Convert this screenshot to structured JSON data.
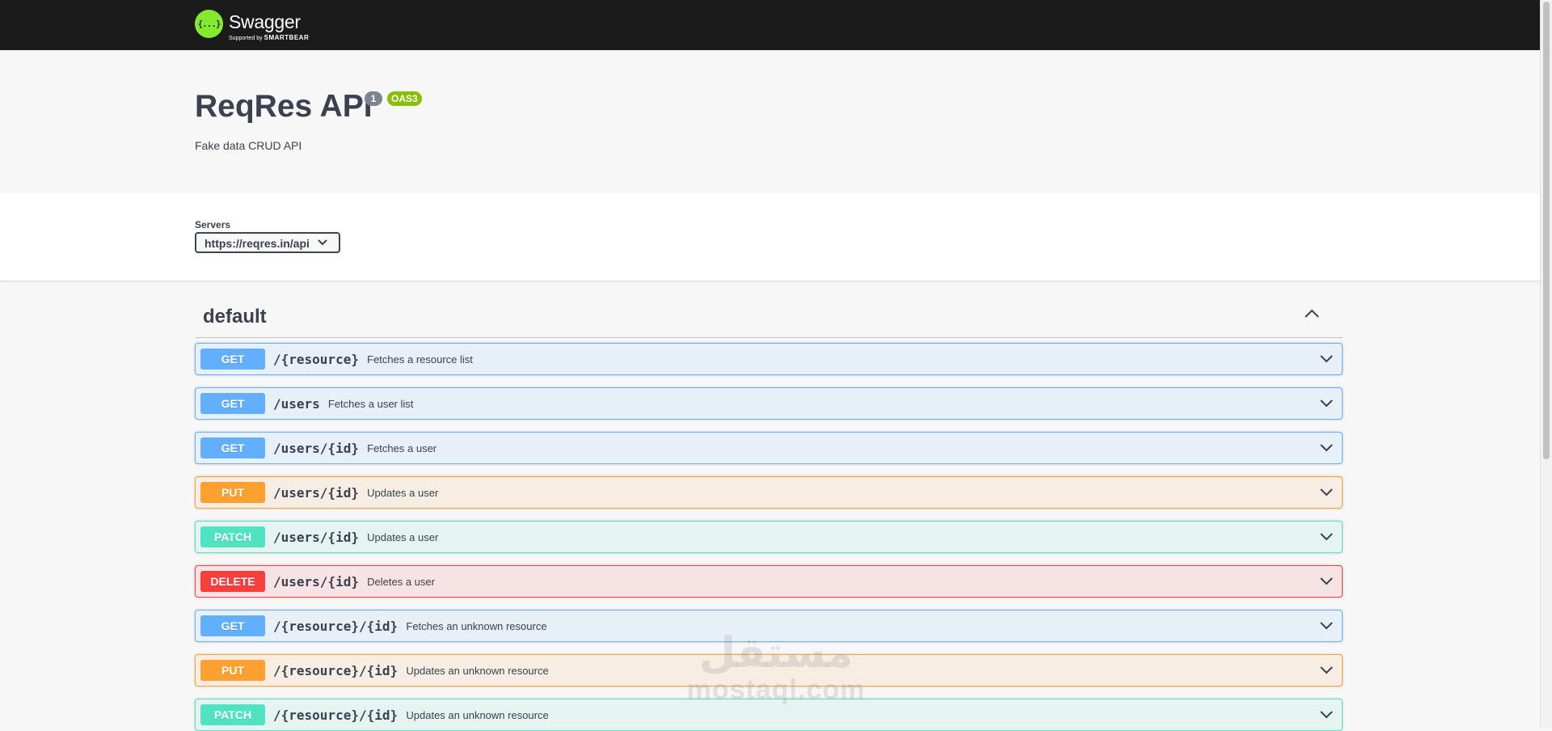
{
  "topbar": {
    "logo_icon_text": "{...}",
    "logo_word": "Swagger",
    "logo_supported": "Supported by",
    "logo_company": "SMARTBEAR"
  },
  "info": {
    "title": "ReqRes API",
    "version": "1",
    "oas_badge": "OAS3",
    "description": "Fake data CRUD API"
  },
  "servers": {
    "label": "Servers",
    "selected": "https://reqres.in/api"
  },
  "tag": {
    "name": "default"
  },
  "operations": [
    {
      "method": "GET",
      "path": "/{resource}",
      "summary": "Fetches a resource list"
    },
    {
      "method": "GET",
      "path": "/users",
      "summary": "Fetches a user list"
    },
    {
      "method": "GET",
      "path": "/users/{id}",
      "summary": "Fetches a user"
    },
    {
      "method": "PUT",
      "path": "/users/{id}",
      "summary": "Updates a user"
    },
    {
      "method": "PATCH",
      "path": "/users/{id}",
      "summary": "Updates a user"
    },
    {
      "method": "DELETE",
      "path": "/users/{id}",
      "summary": "Deletes a user"
    },
    {
      "method": "GET",
      "path": "/{resource}/{id}",
      "summary": "Fetches an unknown resource"
    },
    {
      "method": "PUT",
      "path": "/{resource}/{id}",
      "summary": "Updates an unknown resource"
    },
    {
      "method": "PATCH",
      "path": "/{resource}/{id}",
      "summary": "Updates an unknown resource"
    }
  ],
  "method_colors": {
    "GET": "#61affe",
    "PUT": "#fca130",
    "PATCH": "#50e3c2",
    "DELETE": "#f93e3e"
  },
  "watermark": {
    "arabic": "مستقل",
    "latin": "mostaql.com"
  },
  "icons": {
    "tag_toggle": "chevron-up-icon",
    "operation_toggle": "chevron-down-icon",
    "server_dropdown": "chevron-down-icon"
  }
}
